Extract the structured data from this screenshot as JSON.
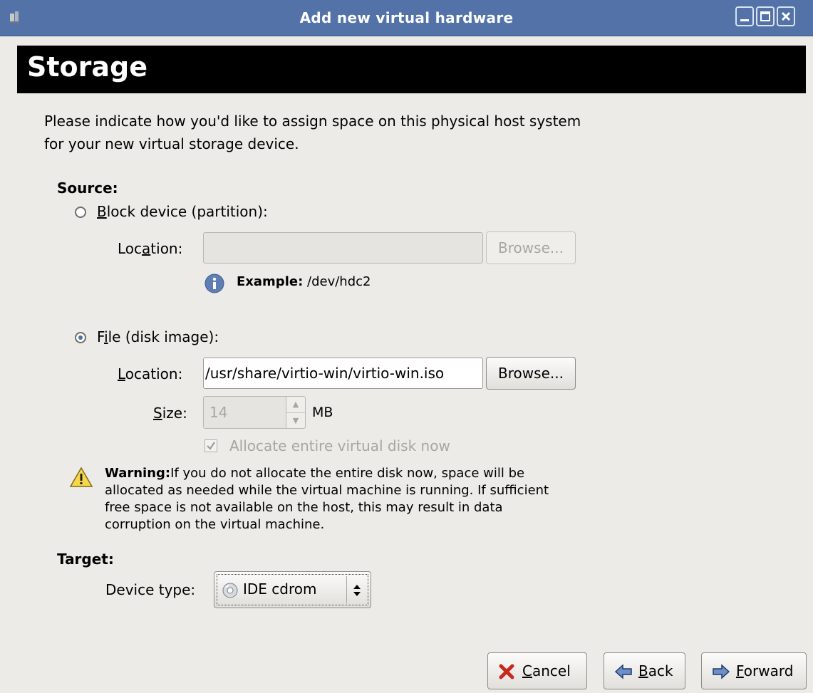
{
  "window": {
    "title": "Add new virtual hardware"
  },
  "header": {
    "title": "Storage"
  },
  "intro": "Please indicate how you'd like to assign space on this physical host system for your new virtual storage device.",
  "source": {
    "heading": "Source:",
    "block_device": {
      "label_prefix": "B",
      "label_rest": "lock device (partition):",
      "selected": false,
      "location_label_pre": "Loc",
      "location_label_ul": "a",
      "location_label_post": "tion:",
      "location_value": "",
      "browse_label": "Browse...",
      "example_bold": "Example:",
      "example_text": "/dev/hdc2"
    },
    "file": {
      "label_pre": "F",
      "label_ul": "i",
      "label_post": "le (disk image):",
      "selected": true,
      "location_label_ul": "L",
      "location_label_post": "ocation:",
      "location_value": "/usr/share/virtio-win/virtio-win.iso",
      "browse_label": "Browse...",
      "size_label_ul": "S",
      "size_label_post": "ize:",
      "size_value": "14",
      "size_unit": "MB",
      "allocate_label": "Allocate entire virtual disk now",
      "allocate_checked": true
    }
  },
  "warning": {
    "bold": "Warning:",
    "text": "If you do not allocate the entire disk now, space will be allocated as needed while the virtual machine is running. If sufficient free space is not available on the host, this may result in data corruption on the virtual machine."
  },
  "target": {
    "heading": "Target:",
    "device_type_label": "Device type:",
    "device_type_value": "IDE cdrom"
  },
  "buttons": {
    "cancel_ul": "C",
    "cancel_post": "ancel",
    "back_ul": "B",
    "back_post": "ack",
    "forward_ul": "F",
    "forward_post": "orward"
  },
  "colors": {
    "titlebar": "#5373a8",
    "header": "#000000",
    "background": "#edebe8"
  }
}
